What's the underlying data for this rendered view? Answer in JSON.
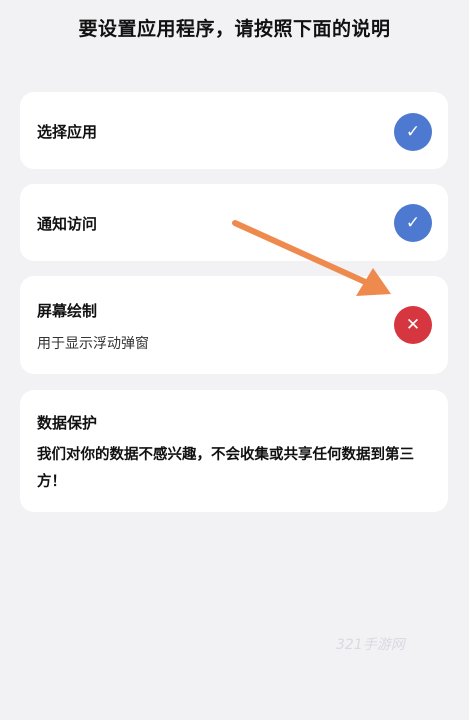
{
  "header": {
    "title": "要设置应用程序，请按照下面的说明"
  },
  "steps": [
    {
      "title": "选择应用",
      "status": "done",
      "status_glyph": "✓"
    },
    {
      "title": "通知访问",
      "status": "done",
      "status_glyph": "✓"
    },
    {
      "title": "屏幕绘制",
      "subtitle": "用于显示浮动弹窗",
      "status": "not_granted",
      "status_glyph": "✕"
    }
  ],
  "privacy": {
    "title": "数据保护",
    "body": "我们对你的数据不感兴趣，不会收集或共享任何数据到第三方！"
  },
  "watermark": "321手游网",
  "colors": {
    "background": "#f2f2f4",
    "card": "#ffffff",
    "check_blue": "#4d79d0",
    "error_red": "#d6363f",
    "arrow_orange": "#ef8a4f"
  },
  "icons": {
    "done": "check-icon",
    "not_granted": "close-icon"
  }
}
